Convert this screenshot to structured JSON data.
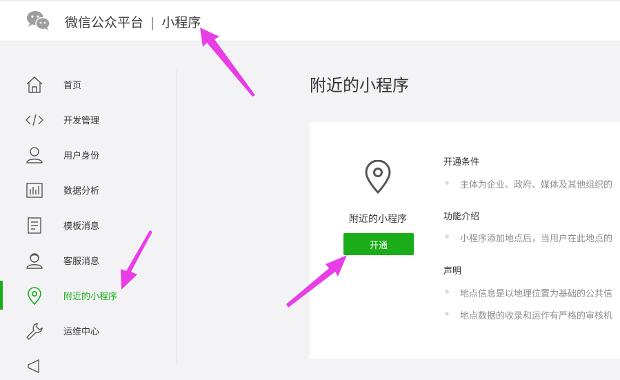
{
  "header": {
    "brand": "微信公众平台",
    "separator": "|",
    "product": "小程序"
  },
  "sidebar": {
    "items": [
      {
        "label": "首页",
        "icon": "home-icon"
      },
      {
        "label": "开发管理",
        "icon": "code-icon"
      },
      {
        "label": "用户身份",
        "icon": "user-icon"
      },
      {
        "label": "数据分析",
        "icon": "chart-icon"
      },
      {
        "label": "模板消息",
        "icon": "document-icon"
      },
      {
        "label": "客服消息",
        "icon": "customer-service-icon"
      },
      {
        "label": "附近的小程序",
        "icon": "location-pin-icon",
        "active": true
      },
      {
        "label": "运维中心",
        "icon": "wrench-icon"
      }
    ]
  },
  "main": {
    "title": "附近的小程序",
    "card": {
      "name": "附近的小程序",
      "button_label": "开通",
      "sections": [
        {
          "title": "开通条件",
          "bullets": [
            "主体为企业、政府、媒体及其他组织的"
          ]
        },
        {
          "title": "功能介绍",
          "bullets": [
            "小程序添加地点后，当用户在此地点的"
          ]
        },
        {
          "title": "声明",
          "bullets": [
            "地点信息是以地理位置为基础的公共信",
            "地点数据的收录和运作有严格的审核机"
          ]
        }
      ]
    }
  },
  "colors": {
    "accent": "#1aad19",
    "annotation_arrow": "#e83ee6",
    "page_bg": "#f3f3f5"
  }
}
